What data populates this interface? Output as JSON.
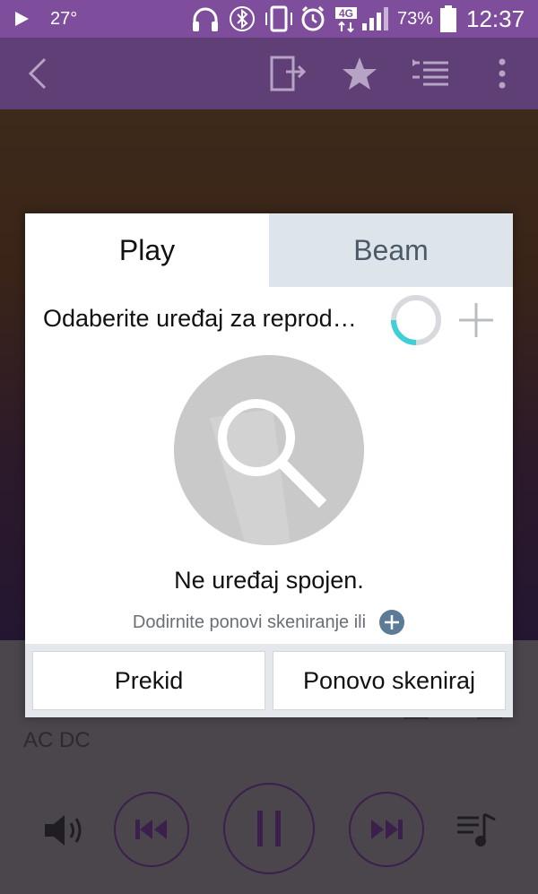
{
  "status_bar": {
    "play_icon": "play-icon",
    "temperature": "27°",
    "battery_percent": "73%",
    "time": "12:37",
    "network": "4G"
  },
  "app_bar": {
    "icons": [
      "back-icon",
      "cast-icon",
      "star-icon",
      "queue-icon",
      "more-icon"
    ]
  },
  "player": {
    "artist": "AC DC"
  },
  "dialog": {
    "tabs": [
      {
        "label": "Play",
        "active": true
      },
      {
        "label": "Beam",
        "active": false
      }
    ],
    "device_title": "Odaberite uređaj za reprod…",
    "empty_message": "Ne uređaj spojen.",
    "hint": "Dodirnite ponovi skeniranje ili",
    "buttons": {
      "cancel": "Prekid",
      "rescan": "Ponovo skeniraj"
    }
  },
  "colors": {
    "status_bar": "#7e4e9c",
    "app_bar": "#5f3f76",
    "spinner_accent": "#3fcfd6",
    "inactive_tab": "#dde4ea",
    "hint_plus": "#5c7b96"
  }
}
